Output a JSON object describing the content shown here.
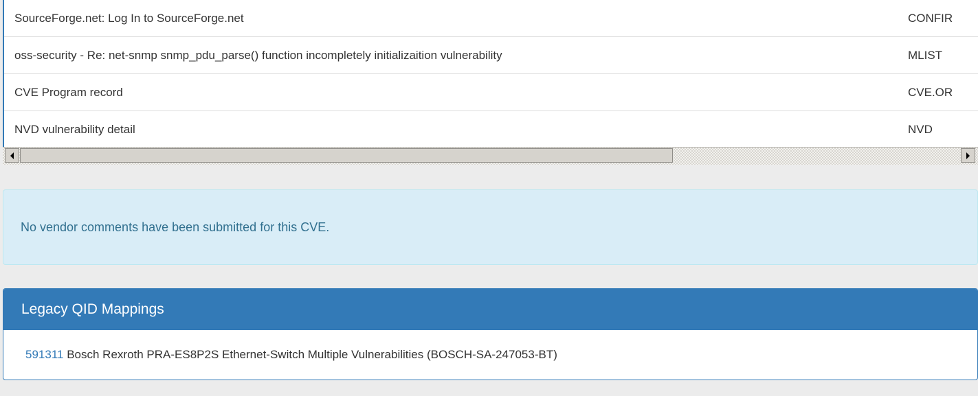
{
  "references": [
    {
      "title": "SourceForge.net: Log In to SourceForge.net",
      "source": "CONFIR"
    },
    {
      "title": "oss-security - Re: net-snmp snmp_pdu_parse() function incompletely initializaition vulnerability",
      "source": "MLIST"
    },
    {
      "title": "CVE Program record",
      "source": "CVE.OR"
    },
    {
      "title": "NVD vulnerability detail",
      "source": "NVD"
    }
  ],
  "vendor_comments": {
    "message": "No vendor comments have been submitted for this CVE."
  },
  "legacy_qid": {
    "heading": "Legacy QID Mappings",
    "items": [
      {
        "qid": "591311",
        "description": "Bosch Rexroth PRA-ES8P2S Ethernet-Switch Multiple Vulnerabilities (BOSCH-SA-247053-BT)"
      }
    ]
  },
  "colors": {
    "primary": "#337ab7",
    "info_bg": "#d9edf7",
    "info_text": "#31708f"
  }
}
